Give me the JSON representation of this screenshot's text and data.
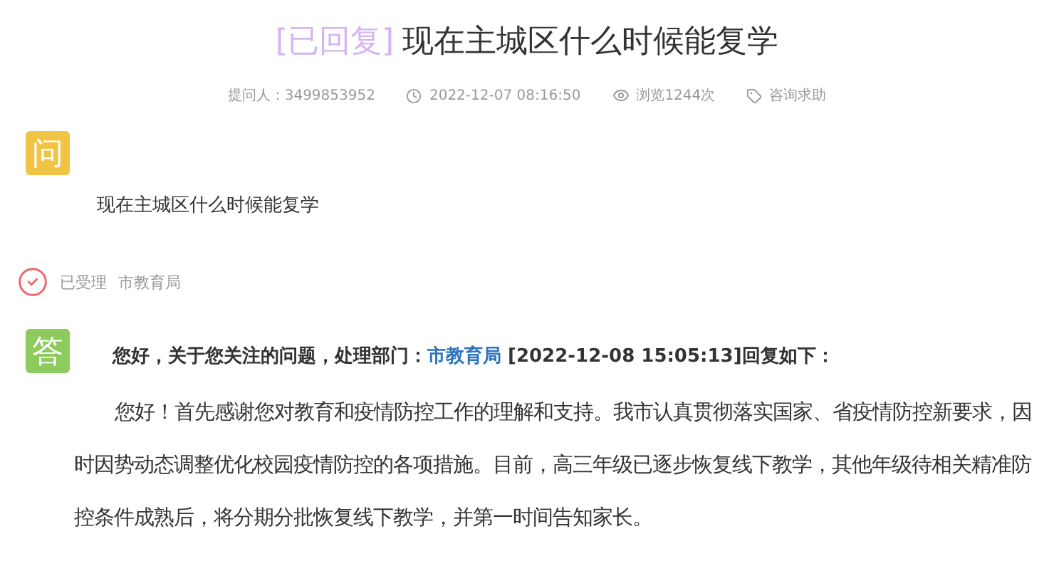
{
  "title": {
    "status": "[已回复]",
    "text": "现在主城区什么时候能复学"
  },
  "meta": [
    {
      "kind": "asker",
      "text": "提问人：3499853952"
    },
    {
      "kind": "time",
      "text": "2022-12-07 08:16:50"
    },
    {
      "kind": "views",
      "text": "浏览1244次"
    },
    {
      "kind": "category",
      "text": "咨询求助"
    }
  ],
  "question": {
    "badge": "问",
    "text": "现在主城区什么时候能复学"
  },
  "handling": {
    "status": "已受理",
    "department": "市教育局"
  },
  "answer": {
    "badge": "答",
    "header_prefix": "您好，关于您关注的问题，处理部门：",
    "department": "市教育局",
    "header_suffix": " [2022-12-08 15:05:13]回复如下：",
    "body": "您好！首先感谢您对教育和疫情防控工作的理解和支持。我市认真贯彻落实国家、省疫情防控新要求，因时因势动态调整优化校园疫情防控的各项措施。目前，高三年级已逐步恢复线下教学，其他年级待相关精准防控条件成熟后，将分期分批恢复线下教学，并第一时间告知家长。"
  }
}
